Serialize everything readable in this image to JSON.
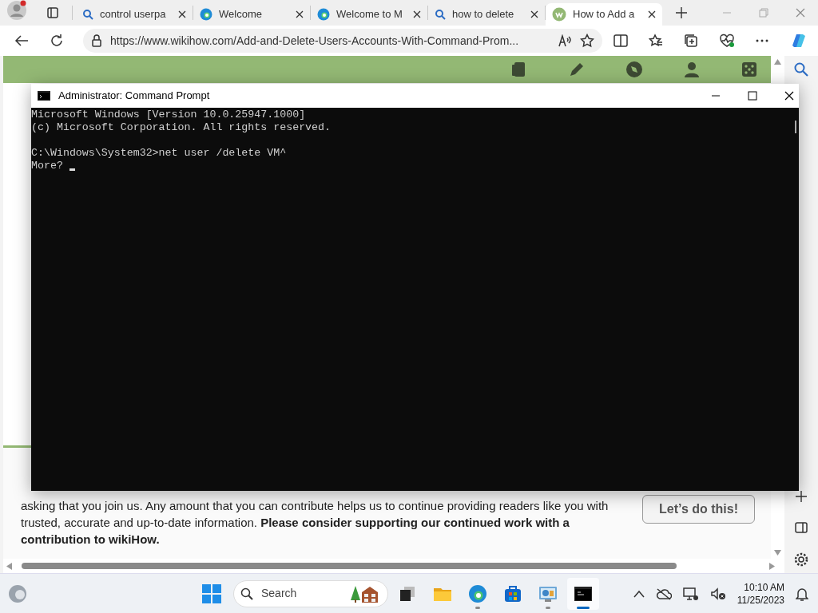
{
  "browser": {
    "tabs": [
      {
        "title": "control userpa",
        "kind": "search",
        "selected": false
      },
      {
        "title": "Welcome",
        "kind": "edge",
        "selected": false
      },
      {
        "title": "Welcome to M",
        "kind": "edge",
        "selected": false
      },
      {
        "title": "how to delete",
        "kind": "search",
        "selected": false
      },
      {
        "title": "How to Add a",
        "kind": "wikihow",
        "selected": true
      }
    ],
    "url": "https://www.wikihow.com/Add-and-Delete-Users-Accounts-With-Command-Prom..."
  },
  "page": {
    "banner": {
      "text": "asking that you join us. Any amount that you can contribute helps us to continue providing readers like you with trusted, accurate and up-to-date information. **Please consider supporting our continued work with a contribution to wikiHow.**",
      "button": "Let’s do this!"
    }
  },
  "console": {
    "title": "Administrator: Command Prompt",
    "header_lines": [
      "Microsoft Windows [Version 10.0.25947.1000]",
      "(c) Microsoft Corporation. All rights reserved."
    ],
    "command_lines": [
      "C:\\Windows\\System32>net user /delete VM^",
      "More? "
    ],
    "cursor": true
  },
  "taskbar": {
    "search_placeholder": "Search",
    "apps": [
      {
        "kind": "taskview",
        "open": false,
        "selected": false
      },
      {
        "kind": "explorer",
        "open": false,
        "selected": false
      },
      {
        "kind": "edge",
        "open": true,
        "selected": false
      },
      {
        "kind": "store",
        "open": false,
        "selected": false
      },
      {
        "kind": "controlpanel",
        "open": true,
        "selected": false
      },
      {
        "kind": "terminal",
        "open": true,
        "selected": true
      }
    ],
    "time": "10:10 AM",
    "date": "11/25/2023"
  }
}
